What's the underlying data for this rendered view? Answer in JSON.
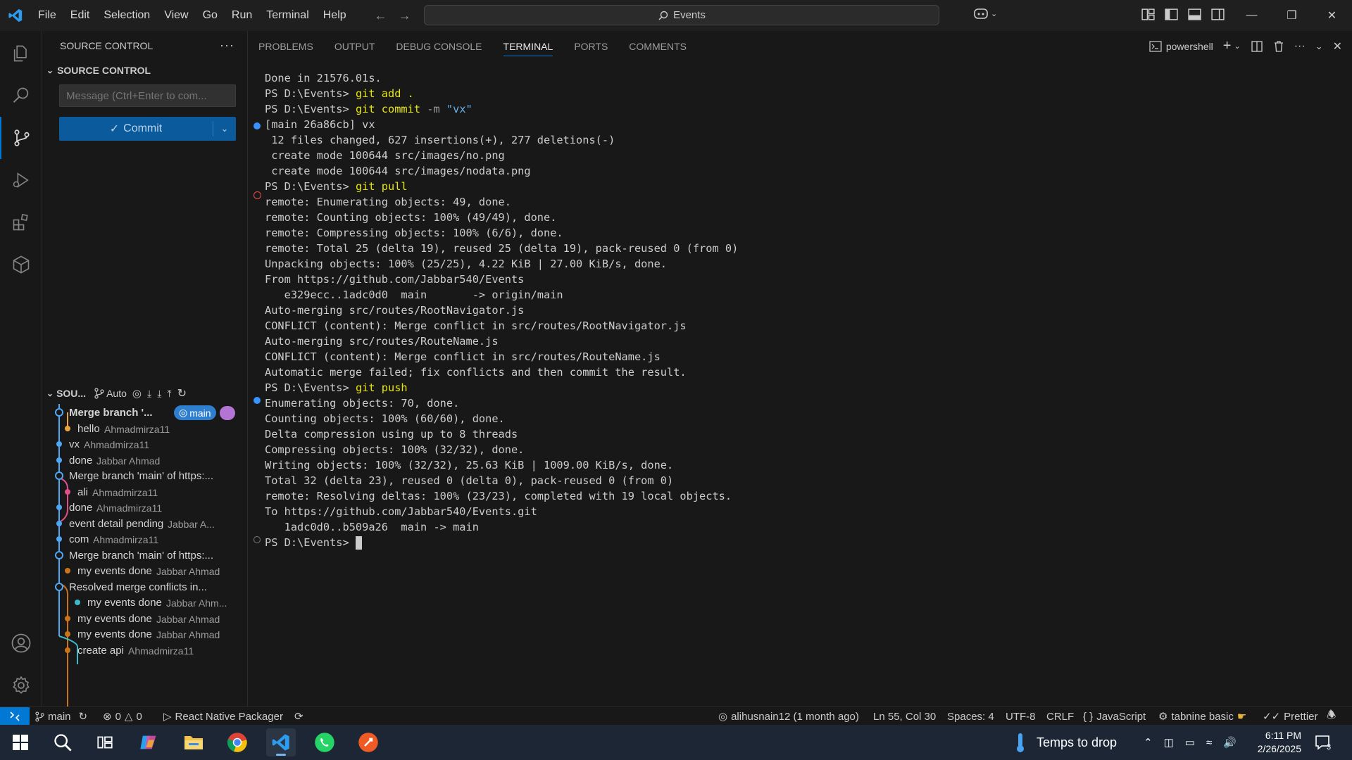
{
  "titlebar": {
    "menu": [
      "File",
      "Edit",
      "Selection",
      "View",
      "Go",
      "Run",
      "Terminal",
      "Help"
    ],
    "search_text": "Events"
  },
  "sidebar": {
    "header": "SOURCE CONTROL",
    "section": "SOURCE CONTROL",
    "message_placeholder": "Message (Ctrl+Enter to com...",
    "commit_label": "Commit",
    "graph_header": "SOU...",
    "graph_auto": "Auto",
    "branch_badge": "main",
    "commits": [
      {
        "msg": "Merge branch '...",
        "author": "",
        "color": "#4fa6f2",
        "bold": true
      },
      {
        "msg": "hello",
        "author": "Ahmadmirza11",
        "color": "#e8a33d",
        "bold": false
      },
      {
        "msg": "vx",
        "author": "Ahmadmirza11",
        "color": "#4fa6f2",
        "bold": false
      },
      {
        "msg": "done",
        "author": "Jabbar Ahmad",
        "color": "#4fa6f2",
        "bold": false
      },
      {
        "msg": "Merge branch 'main' of https:...",
        "author": "",
        "color": "#4fa6f2",
        "bold": false
      },
      {
        "msg": "ali",
        "author": "Ahmadmirza11",
        "color": "#e04f8a",
        "bold": false
      },
      {
        "msg": "done",
        "author": "Ahmadmirza11",
        "color": "#4fa6f2",
        "bold": false
      },
      {
        "msg": "event detail pending",
        "author": "Jabbar A...",
        "color": "#4fa6f2",
        "bold": false
      },
      {
        "msg": "com",
        "author": "Ahmadmirza11",
        "color": "#4fa6f2",
        "bold": false
      },
      {
        "msg": "Merge branch 'main' of https:...",
        "author": "",
        "color": "#4fa6f2",
        "bold": false
      },
      {
        "msg": "my events done",
        "author": "Jabbar Ahmad",
        "color": "#c9741a",
        "bold": false
      },
      {
        "msg": "Resolved merge conflicts in...",
        "author": "",
        "color": "#4fa6f2",
        "bold": false
      },
      {
        "msg": "my events done",
        "author": "Jabbar Ahm...",
        "color": "#3fb8c9",
        "bold": false
      },
      {
        "msg": "my events done",
        "author": "Jabbar Ahmad",
        "color": "#c9741a",
        "bold": false
      },
      {
        "msg": "my events done",
        "author": "Jabbar Ahmad",
        "color": "#c9741a",
        "bold": false
      },
      {
        "msg": "create api",
        "author": "Ahmadmirza11",
        "color": "#c9741a",
        "bold": false
      }
    ]
  },
  "panel": {
    "tabs": [
      "PROBLEMS",
      "OUTPUT",
      "DEBUG CONSOLE",
      "TERMINAL",
      "PORTS",
      "COMMENTS"
    ],
    "active_tab": "TERMINAL",
    "shell": "powershell"
  },
  "terminal": {
    "prompt": "PS D:\\Events> ",
    "lines": [
      "Done in 21576.01s.",
      "",
      "",
      "[main 26a86cb] vx",
      " 12 files changed, 627 insertions(+), 277 deletions(-)",
      " create mode 100644 src/images/no.png",
      " create mode 100644 src/images/nodata.png",
      "",
      "remote: Enumerating objects: 49, done.",
      "remote: Counting objects: 100% (49/49), done.",
      "remote: Compressing objects: 100% (6/6), done.",
      "remote: Total 25 (delta 19), reused 25 (delta 19), pack-reused 0 (from 0)",
      "Unpacking objects: 100% (25/25), 4.22 KiB | 27.00 KiB/s, done.",
      "From https://github.com/Jabbar540/Events",
      "   e329ecc..1adc0d0  main       -> origin/main",
      "Auto-merging src/routes/RootNavigator.js",
      "CONFLICT (content): Merge conflict in src/routes/RootNavigator.js",
      "Auto-merging src/routes/RouteName.js",
      "CONFLICT (content): Merge conflict in src/routes/RouteName.js",
      "Automatic merge failed; fix conflicts and then commit the result.",
      "",
      "Enumerating objects: 70, done.",
      "Counting objects: 100% (60/60), done.",
      "Delta compression using up to 8 threads",
      "Compressing objects: 100% (32/32), done.",
      "Writing objects: 100% (32/32), 25.63 KiB | 1009.00 KiB/s, done.",
      "Total 32 (delta 23), reused 0 (delta 0), pack-reused 0 (from 0)",
      "remote: Resolving deltas: 100% (23/23), completed with 19 local objects.",
      "To https://github.com/Jabbar540/Events.git",
      "   1adc0d0..b509a26  main -> main"
    ],
    "cmd_add": "git add .",
    "cmd_commit": "git commit",
    "cmd_commit_flag": "-m",
    "cmd_commit_msg": "\"vx\"",
    "cmd_pull": "git pull",
    "cmd_push": "git push"
  },
  "statusbar": {
    "branch": "main",
    "errors": "0",
    "warnings": "0",
    "packager": "React Native Packager",
    "blame": "alihusnain12 (1 month ago)",
    "position": "Ln 55, Col 30",
    "spaces": "Spaces: 4",
    "encoding": "UTF-8",
    "eol": "CRLF",
    "language": "JavaScript",
    "tabnine": "tabnine basic",
    "prettier": "Prettier"
  },
  "taskbar": {
    "weather": "Temps to drop",
    "time": "6:11 PM",
    "date": "2/26/2025",
    "notif_count": "3"
  },
  "colors": {
    "accent": "#0078d4",
    "prompt_cmd": "#e5e510",
    "info_dot": "#3794ff",
    "error_dot": "#f14c4c"
  }
}
